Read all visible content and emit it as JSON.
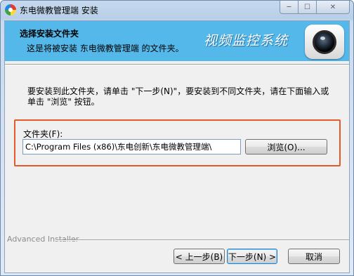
{
  "window": {
    "title": "东电微教管理端 安装",
    "controls": {
      "minimize": "─",
      "maximize": "☐",
      "close": "✕"
    }
  },
  "banner": {
    "title": "选择安装文件夹",
    "subtitle": "这是将被安装 东电微教管理端 的文件夹。",
    "brand_text": "视频监控系统",
    "brand_color": "#54b8ea",
    "logo_icon": "camera-lens-icon"
  },
  "body": {
    "description": "要安装到此文件夹，请单击 \"下一步(N)\"，要安装到不同文件夹，请在下面输入或单击 \"浏览\" 按钮。",
    "folder_label": "文件夹(F):",
    "folder_path": "C:\\Program Files (x86)\\东电创新\\东电微教管理端\\",
    "browse_label": "浏览(O)...",
    "highlight_color": "#e35a2b"
  },
  "footer": {
    "installer_label": "Advanced Installer",
    "back_label": "< 上一步(B)",
    "next_label": "下一步(N) >",
    "cancel_label": "取消"
  }
}
